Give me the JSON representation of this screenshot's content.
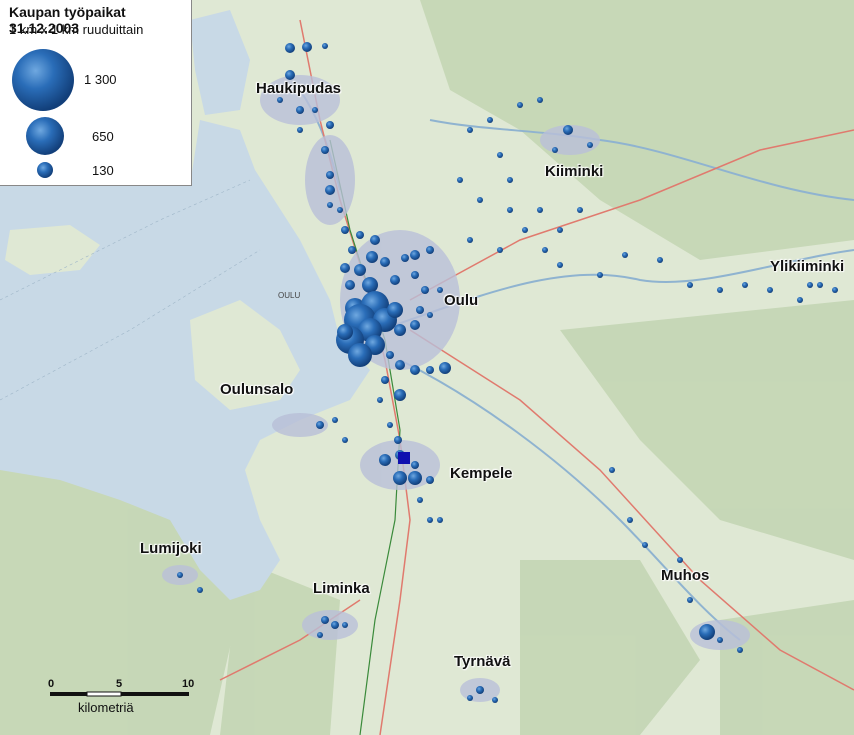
{
  "legend": {
    "title": "Kaupan työpaikat 31.12.2003",
    "subtitle": "1 km x 1 km ruuduittain",
    "sizes": [
      {
        "label": "1 300",
        "value": 1300
      },
      {
        "label": "650",
        "value": 650
      },
      {
        "label": "130",
        "value": 130
      }
    ]
  },
  "places": [
    {
      "id": "haukipudas",
      "name": "Haukipudas"
    },
    {
      "id": "kiiminki",
      "name": "Kiiminki"
    },
    {
      "id": "ylikiiminki",
      "name": "Ylikiiminki"
    },
    {
      "id": "oulu",
      "name": "Oulu"
    },
    {
      "id": "oulunsalo",
      "name": "Oulunsalo"
    },
    {
      "id": "kempele",
      "name": "Kempele"
    },
    {
      "id": "lumijoki",
      "name": "Lumijoki"
    },
    {
      "id": "liminka",
      "name": "Liminka"
    },
    {
      "id": "muhos",
      "name": "Muhos"
    },
    {
      "id": "tyrnava",
      "name": "Tyrnävä"
    }
  ],
  "sea_label": "OULU",
  "scale": {
    "ticks": [
      "0",
      "5",
      "10"
    ],
    "unit": "kilometriä"
  },
  "colors": {
    "sea": "#c8d9e6",
    "land": "#dfe8d4",
    "forest": "#c4d6b4",
    "bubble": "#1f5fa8",
    "highlight_square": "#1010b0"
  }
}
